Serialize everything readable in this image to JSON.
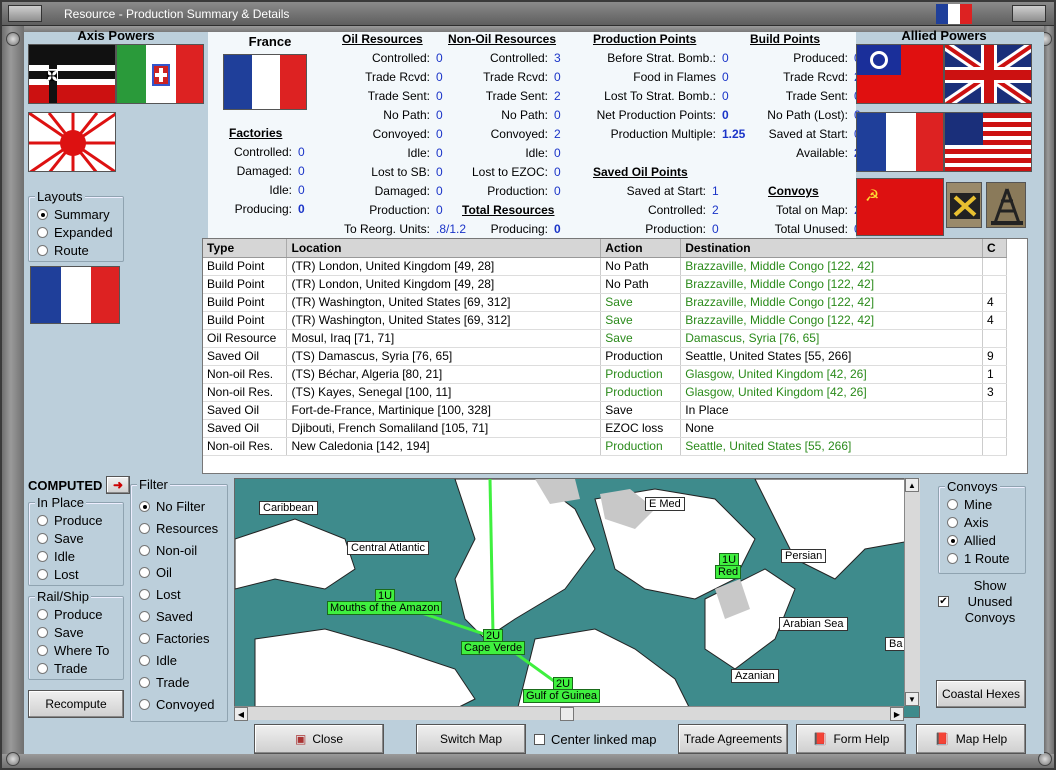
{
  "window": {
    "title": "Resource - Production Summary & Details"
  },
  "axis": {
    "title": "Axis Powers"
  },
  "allied": {
    "title": "Allied Powers"
  },
  "layouts": {
    "title": "Layouts",
    "options": [
      "Summary",
      "Expanded",
      "Route"
    ],
    "selected": "Summary"
  },
  "summary": {
    "country": "France",
    "factories": {
      "title": "Factories",
      "rows": [
        {
          "k": "Controlled:",
          "v": "0"
        },
        {
          "k": "Damaged:",
          "v": "0"
        },
        {
          "k": "Idle:",
          "v": "0"
        },
        {
          "k": "Producing:",
          "v": "0"
        }
      ]
    },
    "oil": {
      "title": "Oil Resources",
      "rows": [
        {
          "k": "Controlled:",
          "v": "0"
        },
        {
          "k": "Trade Rcvd:",
          "v": "0"
        },
        {
          "k": "Trade Sent:",
          "v": "0"
        },
        {
          "k": "No Path:",
          "v": "0"
        },
        {
          "k": "Convoyed:",
          "v": "0"
        },
        {
          "k": "Idle:",
          "v": "0"
        },
        {
          "k": "Lost to SB:",
          "v": "0"
        },
        {
          "k": "Damaged:",
          "v": "0"
        },
        {
          "k": "Production:",
          "v": "0"
        },
        {
          "k": "To Reorg. Units:",
          "v": ".8/1.2"
        }
      ]
    },
    "nonoil": {
      "title": "Non-Oil Resources",
      "rows": [
        {
          "k": "Controlled:",
          "v": "3"
        },
        {
          "k": "Trade Rcvd:",
          "v": "0"
        },
        {
          "k": "Trade Sent:",
          "v": "2"
        },
        {
          "k": "No Path:",
          "v": "0"
        },
        {
          "k": "Convoyed:",
          "v": "2"
        },
        {
          "k": "Idle:",
          "v": "0"
        },
        {
          "k": "Lost to EZOC:",
          "v": "0"
        },
        {
          "k": "Production:",
          "v": "0"
        }
      ]
    },
    "total": {
      "title": "Total Resources",
      "rows": [
        {
          "k": "Producing:",
          "v": "0"
        }
      ]
    },
    "prodpoints": {
      "title": "Production Points",
      "rows": [
        {
          "k": "Before Strat. Bomb.:",
          "v": "0"
        },
        {
          "k": "Food in Flames",
          "v": "0"
        },
        {
          "k": "Lost To Strat. Bomb.:",
          "v": "0"
        },
        {
          "k": "Net Production Points:",
          "v": "0"
        },
        {
          "k": "Production Multiple:",
          "v": "1.25"
        }
      ]
    },
    "savedoil": {
      "title": "Saved Oil Points",
      "rows": [
        {
          "k": "Saved at Start:",
          "v": "1"
        },
        {
          "k": "Controlled:",
          "v": "2"
        },
        {
          "k": "Production:",
          "v": "0"
        }
      ]
    },
    "build": {
      "title": "Build Points",
      "rows": [
        {
          "k": "Produced:",
          "v": "0"
        },
        {
          "k": "Trade Rcvd:",
          "v": "2"
        },
        {
          "k": "Trade Sent:",
          "v": "0"
        },
        {
          "k": "No Path (Lost):",
          "v": "0"
        },
        {
          "k": "Saved at Start:",
          "v": "0"
        },
        {
          "k": "Available:",
          "v": "2"
        }
      ]
    },
    "convoys": {
      "title": "Convoys",
      "rows": [
        {
          "k": "Total on Map:",
          "v": "2"
        },
        {
          "k": "Total Unused:",
          "v": "0"
        }
      ]
    }
  },
  "table": {
    "headers": [
      "Type",
      "Location",
      "Action",
      "Destination",
      "C"
    ],
    "rows": [
      [
        "Build Point",
        "(TR) London, United Kingdom [49, 28]",
        "No Path",
        "Brazzaville, Middle Congo [122, 42]",
        ""
      ],
      [
        "Build Point",
        "(TR) London, United Kingdom [49, 28]",
        "No Path",
        "Brazzaville, Middle Congo [122, 42]",
        ""
      ],
      [
        "Build Point",
        "(TR) Washington, United States [69, 312]",
        "Save",
        "Brazzaville, Middle Congo [122, 42]",
        "4"
      ],
      [
        "Build Point",
        "(TR) Washington, United States [69, 312]",
        "Save",
        "Brazzaville, Middle Congo [122, 42]",
        "4"
      ],
      [
        "Oil Resource",
        "Mosul, Iraq [71, 71]",
        "Save",
        "Damascus, Syria [76, 65]",
        ""
      ],
      [
        "Saved Oil",
        "(TS) Damascus, Syria [76, 65]",
        "Production",
        "Seattle, United States [55, 266]",
        "9"
      ],
      [
        "Non-oil Res.",
        "(TS) Béchar, Algeria [80, 21]",
        "Production",
        "Glasgow, United Kingdom [42, 26]",
        "1"
      ],
      [
        "Non-oil Res.",
        "(TS) Kayes, Senegal [100, 11]",
        "Production",
        "Glasgow, United Kingdom [42, 26]",
        "3"
      ],
      [
        "Saved Oil",
        "Fort-de-France, Martinique [100, 328]",
        "Save",
        "In Place",
        ""
      ],
      [
        "Saved Oil",
        "Djibouti, French Somaliland [105, 71]",
        "EZOC loss",
        "None",
        ""
      ],
      [
        "Non-oil Res.",
        "New Caledonia [142, 194]",
        "Production",
        "Seattle, United States [55, 266]",
        ""
      ]
    ],
    "green_action": [
      false,
      false,
      true,
      true,
      true,
      false,
      true,
      true,
      false,
      false,
      true
    ],
    "green_dest": [
      true,
      true,
      true,
      true,
      true,
      false,
      true,
      true,
      false,
      false,
      true
    ]
  },
  "computed": {
    "label": "COMPUTED"
  },
  "inplace": {
    "title": "In Place",
    "options": [
      "Produce",
      "Save",
      "Idle",
      "Lost"
    ]
  },
  "railship": {
    "title": "Rail/Ship",
    "options": [
      "Produce",
      "Save",
      "Where To",
      "Trade"
    ]
  },
  "filter": {
    "title": "Filter",
    "options": [
      "No Filter",
      "Resources",
      "Non-oil",
      "Oil",
      "Lost",
      "Saved",
      "Factories",
      "Idle",
      "Trade",
      "Convoyed"
    ],
    "selected": "No Filter"
  },
  "convoys_box": {
    "title": "Convoys",
    "options": [
      "Mine",
      "Axis",
      "Allied",
      "1 Route"
    ],
    "selected": "Allied"
  },
  "show_unused": {
    "label": "Show Unused Convoys",
    "checked": true
  },
  "map": {
    "labels": [
      "Caribbean",
      "Central Atlantic",
      "E Med",
      "Persian",
      "Arabian Sea",
      "Azanian",
      "Ba"
    ],
    "green_labels": [
      "Mouths of the Amazon",
      "Cape Verde",
      "Gulf of Guinea",
      "Red"
    ],
    "unit_tags": [
      "1U",
      "2U",
      "2U",
      "1U"
    ]
  },
  "buttons": {
    "recompute": "Recompute",
    "coastal": "Coastal Hexes",
    "close": "Close",
    "switch_map": "Switch Map",
    "center_linked": "Center linked map",
    "trade": "Trade Agreements",
    "form_help": "Form Help",
    "map_help": "Map Help"
  }
}
